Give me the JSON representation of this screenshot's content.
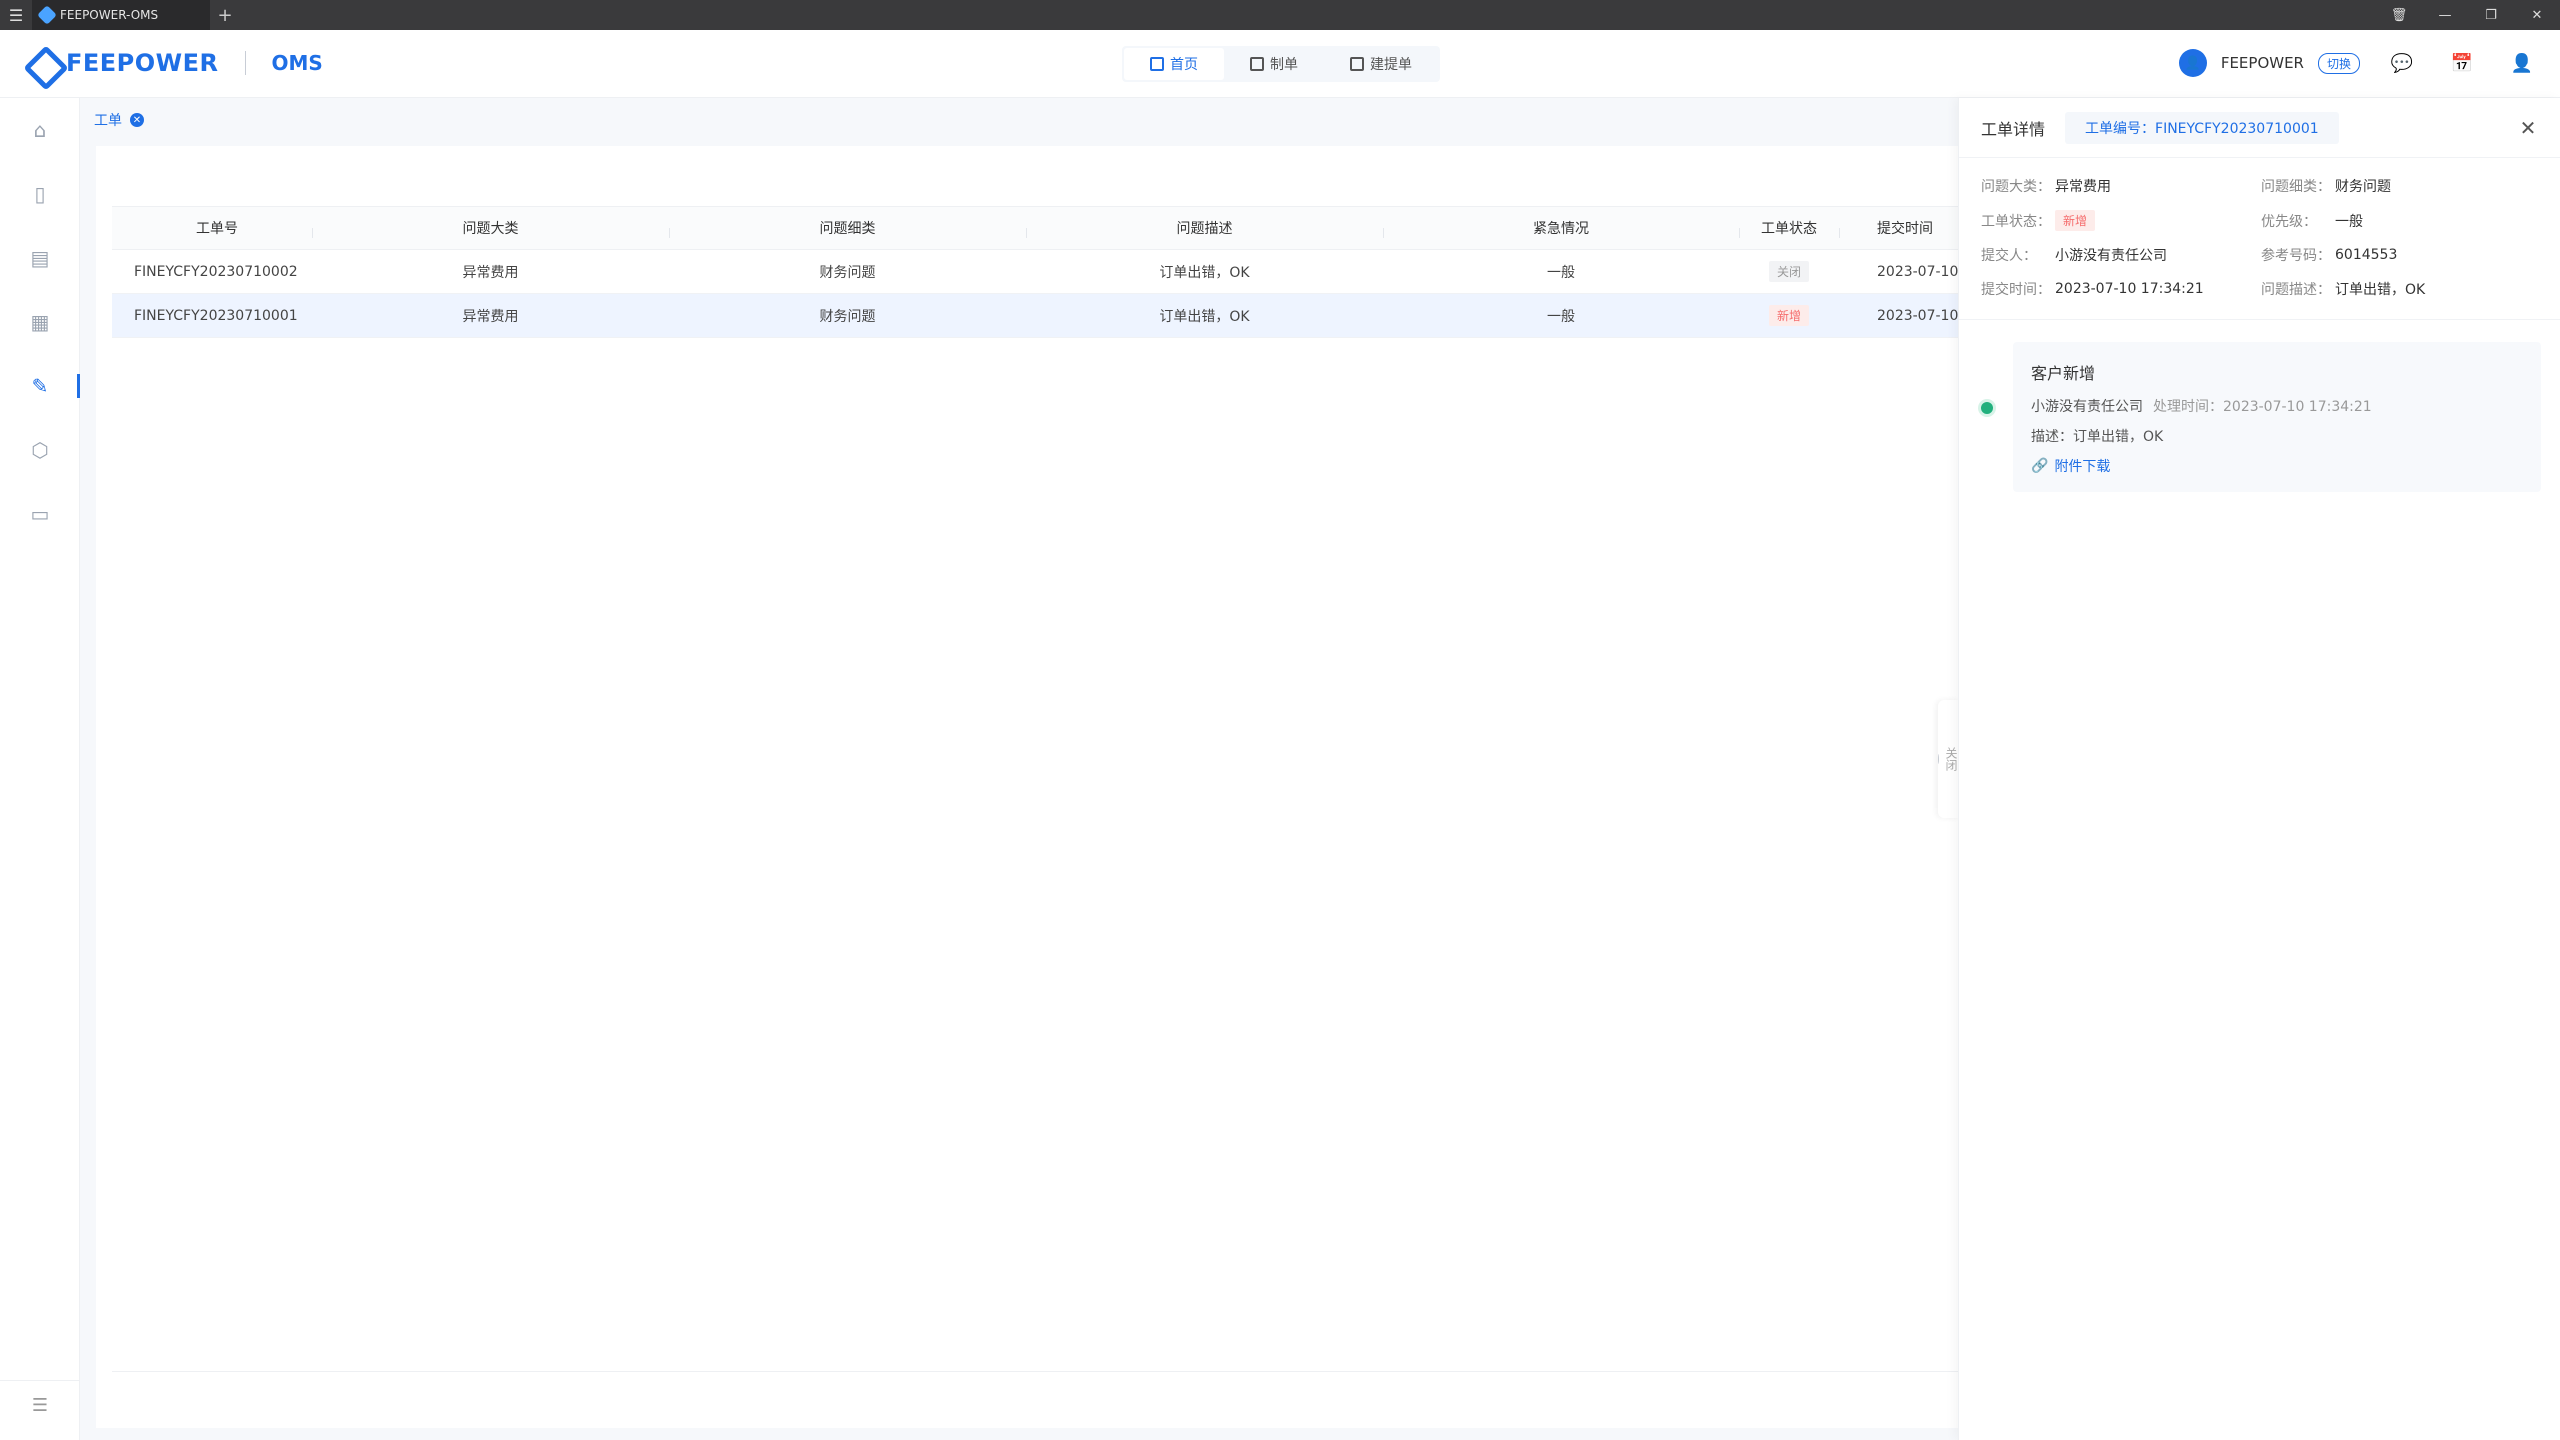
{
  "window": {
    "tab_title": "FEEPOWER-OMS",
    "new_tab": "+",
    "controls": [
      "🗑",
      "—",
      "❐",
      "✕"
    ]
  },
  "header": {
    "logo_text": "FEEPOWER",
    "product": "OMS",
    "nav": [
      {
        "label": "首页",
        "active": true
      },
      {
        "label": "制单",
        "active": false
      },
      {
        "label": "建提单",
        "active": false
      }
    ],
    "user_name": "FEEPOWER",
    "switch_label": "切换"
  },
  "tabs": [
    {
      "label": "工单"
    }
  ],
  "table": {
    "columns": [
      "工单号",
      "问题大类",
      "问题细类",
      "问题描述",
      "紧急情况",
      "工单状态",
      "提交时间"
    ],
    "rows": [
      {
        "id": "FINEYCFY20230710002",
        "category": "异常费用",
        "subcategory": "财务问题",
        "desc": "订单出错，OK",
        "urgency": "一般",
        "status": "关闭",
        "time": "2023-07-10 1"
      },
      {
        "id": "FINEYCFY20230710001",
        "category": "异常费用",
        "subcategory": "财务问题",
        "desc": "订单出错，OK",
        "urgency": "一般",
        "status": "新增",
        "time": "2023-07-10 1"
      }
    ]
  },
  "handle": {
    "label": "关闭"
  },
  "drawer": {
    "title": "工单详情",
    "order_no": "工单编号：FINEYCFY20230710001",
    "fields": {
      "category_k": "问题大类：",
      "category_v": "异常费用",
      "subcat_k": "问题细类：",
      "subcat_v": "财务问题",
      "status_k": "工单状态：",
      "status_v": "新增",
      "priority_k": "优先级：",
      "priority_v": "一般",
      "submitter_k": "提交人：",
      "submitter_v": "小游没有责任公司",
      "ref_k": "参考号码：",
      "ref_v": "6014553",
      "time_k": "提交时间：",
      "time_v": "2023-07-10 17:34:21",
      "desc_k": "问题描述：",
      "desc_v": "订单出错，OK"
    },
    "timeline": {
      "title": "客户新增",
      "company": "小游没有责任公司",
      "handled": "处理时间：2023-07-10 17:34:21",
      "desc": "描述：订单出错，OK",
      "download": "附件下载"
    }
  }
}
